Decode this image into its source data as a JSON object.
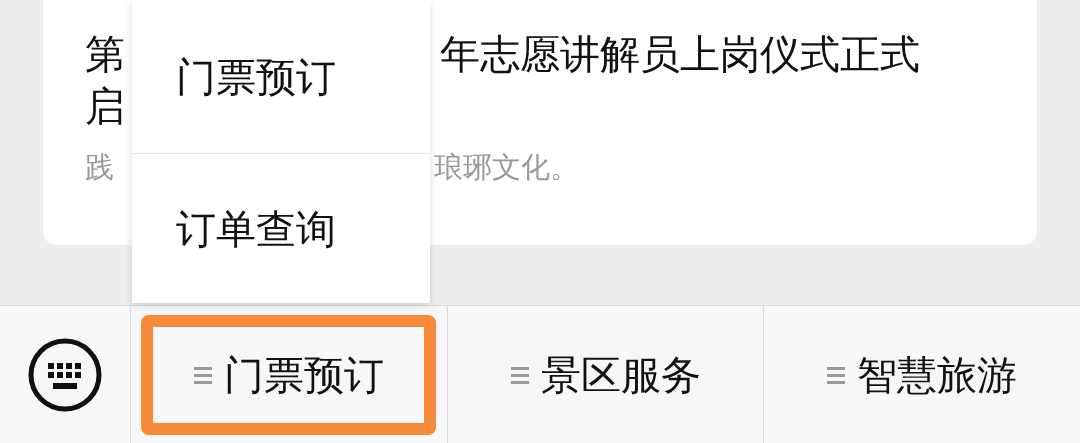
{
  "article": {
    "title_line_1": [
      "第",
      "年志愿讲解员上岗仪式正式"
    ],
    "title_line_2": "启",
    "summary": [
      "践",
      "琅琊文化。"
    ]
  },
  "submenu": {
    "items": [
      {
        "label": "门票预订"
      },
      {
        "label": "订单查询"
      }
    ]
  },
  "menu_bar": {
    "items": [
      {
        "label": "门票预订",
        "selected": true
      },
      {
        "label": "景区服务",
        "selected": false
      },
      {
        "label": "智慧旅游",
        "selected": false
      }
    ]
  }
}
